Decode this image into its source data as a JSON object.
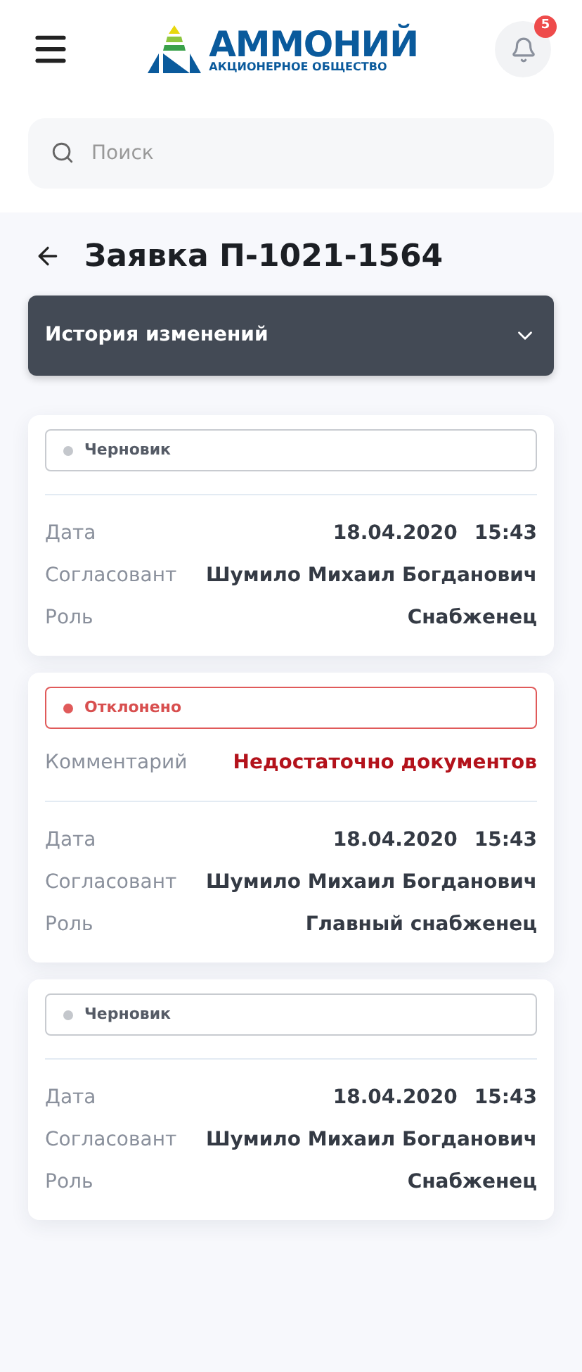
{
  "header": {
    "logo": {
      "name": "АММОНИЙ",
      "subtitle": "АКЦИОНЕРНОЕ ОБЩЕСТВО"
    },
    "notifications_count": "5"
  },
  "search": {
    "placeholder": "Поиск"
  },
  "title": "Заявка П-1021-1564",
  "history_panel": {
    "title": "История изменений",
    "expanded": false
  },
  "entries": [
    {
      "status": {
        "kind": "draft",
        "label": "Черновик",
        "color": "#c4c7cc"
      },
      "date": "18.04.2020",
      "time": "15:43",
      "fields": [
        {
          "label": "Дата"
        },
        {
          "label": "Согласовант",
          "value": "Шумило Михаил Богданович"
        },
        {
          "label": "Роль",
          "value": "Снабженец"
        }
      ]
    },
    {
      "status": {
        "kind": "rejected",
        "label": "Отклонено",
        "color": "#e05a5a"
      },
      "comment": {
        "label": "Комментарий",
        "value": "Недостаточно документов"
      },
      "date": "18.04.2020",
      "time": "15:43",
      "fields": [
        {
          "label": "Дата"
        },
        {
          "label": "Согласовант",
          "value": "Шумило Михаил Богданович"
        },
        {
          "label": "Роль",
          "value": "Главный снабженец"
        }
      ]
    },
    {
      "status": {
        "kind": "draft",
        "label": "Черновик",
        "color": "#c4c7cc"
      },
      "date": "18.04.2020",
      "time": "15:43",
      "fields": [
        {
          "label": "Дата"
        },
        {
          "label": "Согласовант",
          "value": "Шумило Михаил Богданович"
        },
        {
          "label": "Роль",
          "value": "Снабженец"
        }
      ]
    }
  ]
}
